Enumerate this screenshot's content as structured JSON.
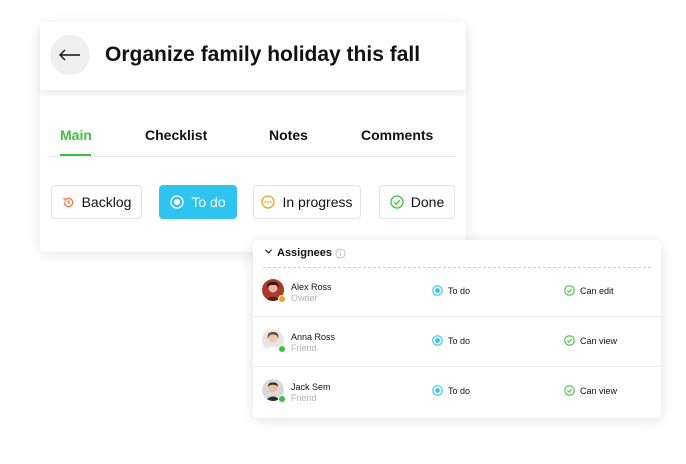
{
  "task": {
    "title": "Organize family holiday this fall",
    "back_icon": "arrow-left-icon"
  },
  "tabs": [
    {
      "label": "Main",
      "active": true
    },
    {
      "label": "Checklist",
      "active": false
    },
    {
      "label": "Notes",
      "active": false
    },
    {
      "label": "Comments",
      "active": false
    }
  ],
  "statuses": [
    {
      "label": "Backlog",
      "icon": "backlog-icon",
      "color": "#f07a4a",
      "selected": false
    },
    {
      "label": "To do",
      "icon": "todo-icon",
      "color": "#ffffff",
      "selected": true
    },
    {
      "label": "In progress",
      "icon": "in-progress-icon",
      "color": "#f0a21c",
      "selected": false
    },
    {
      "label": "Done",
      "icon": "done-icon",
      "color": "#3fbf3f",
      "selected": false
    }
  ],
  "assignees": {
    "title": "Assignees",
    "rows": [
      {
        "name": "Alex Ross",
        "role": "Owner",
        "status": "To do",
        "permission": "Can edit"
      },
      {
        "name": "Anna Ross",
        "role": "Friend",
        "status": "To do",
        "permission": "Can view"
      },
      {
        "name": "Jack Sem",
        "role": "Friend",
        "status": "To do",
        "permission": "Can view"
      }
    ]
  },
  "colors": {
    "accent_green": "#3fbf3f",
    "todo_blue": "#2fc3f0",
    "backlog_orange": "#f07a4a",
    "progress_amber": "#f0a21c"
  }
}
